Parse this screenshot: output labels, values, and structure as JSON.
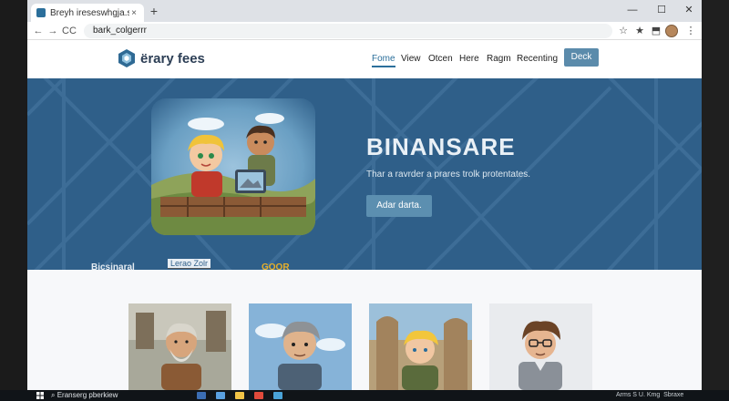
{
  "browser": {
    "tab_title": "Breyh ireseswhgja.s",
    "tab_close": "×",
    "new_tab": "+",
    "address": "bark_colgerrr",
    "window_controls": [
      "—",
      "☐",
      "✕"
    ],
    "nav_icons": [
      "back-arrow-icon",
      "forward-arrow-icon",
      "reload-icon"
    ],
    "nav_glyphs": [
      "←",
      "→",
      "C"
    ],
    "reload_prefix": "C"
  },
  "site": {
    "brand": "ërary fees",
    "nav": [
      "Fome",
      "View",
      "Otcen",
      "Here",
      "Ragm",
      "Recenting"
    ],
    "deck_button": "Deck"
  },
  "hero": {
    "title": "BINANSARE",
    "subtitle": "Thar a ravrder a prares trolk protentates.",
    "cta": "Adar darta.",
    "partners": [
      "Bicsinaral",
      "Lerao Zolr",
      "GOOR"
    ]
  },
  "taskbar": {
    "search_text": "Eranserg pberkiew",
    "tray_text": "Arms S U. Kmg",
    "tray_text2": "Sbraxe"
  },
  "colors": {
    "hero_bg": "#2f5f89",
    "accent": "#5b8bab",
    "brand_text": "#2c3e55",
    "partner_gold": "#e7b02a"
  }
}
